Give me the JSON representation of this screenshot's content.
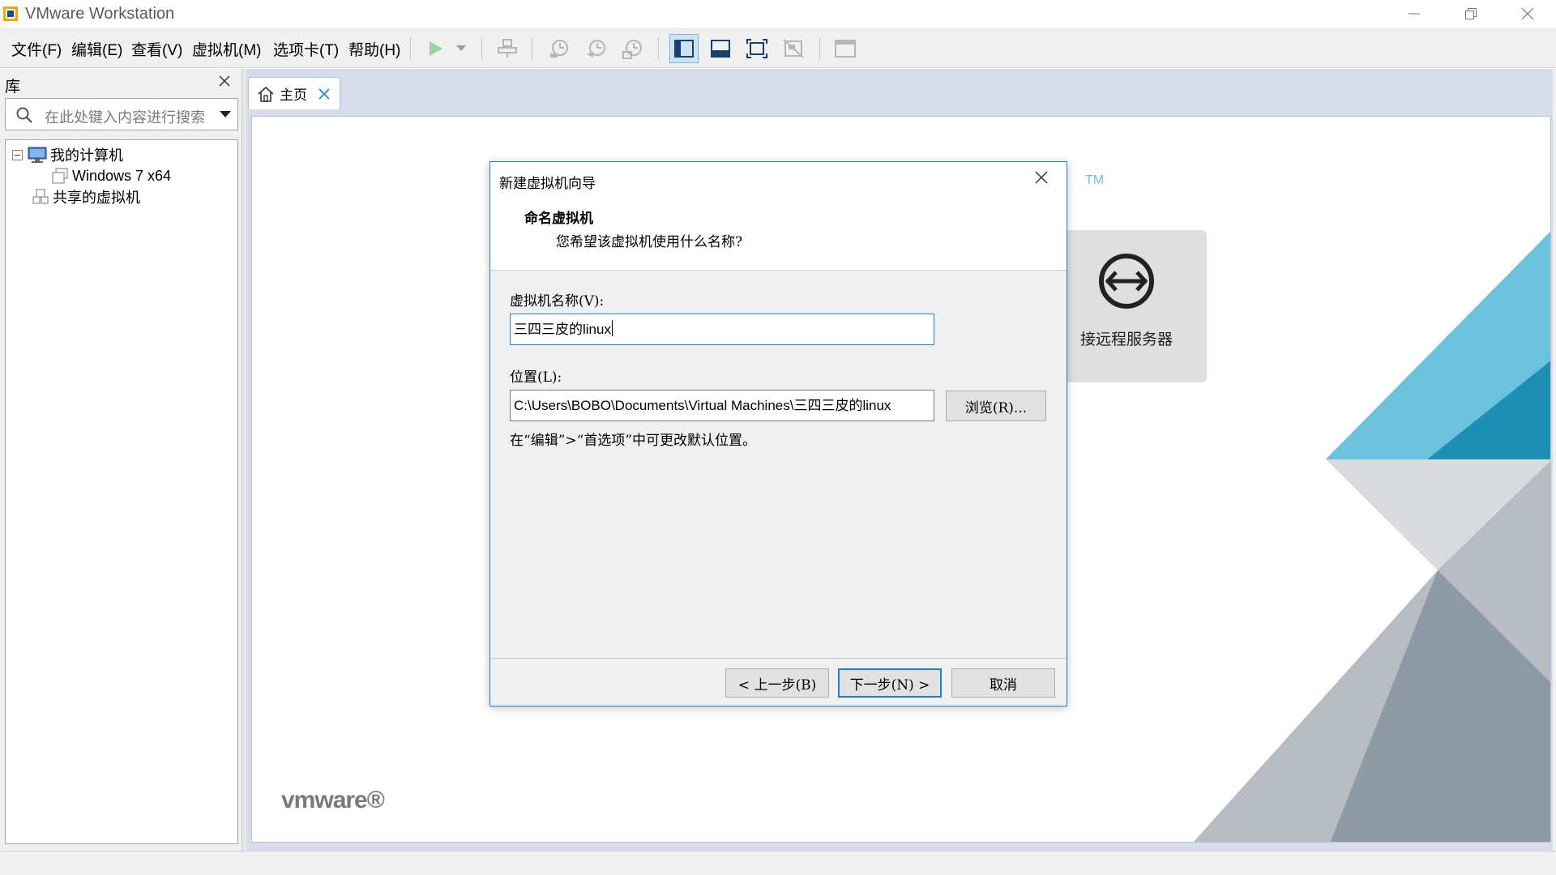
{
  "window": {
    "title": "VMware Workstation"
  },
  "menu": {
    "items": [
      "文件(F)",
      "编辑(E)",
      "查看(V)",
      "虚拟机(M)",
      "选项卡(T)",
      "帮助(H)"
    ]
  },
  "toolbar": {
    "icons": [
      "play-icon",
      "play-dropdown-icon",
      "send-ctrl-alt-del-icon",
      "snapshot-take-icon",
      "snapshot-revert-icon",
      "snapshot-manager-icon",
      "show-library-icon",
      "show-thumbnail-bar-icon",
      "full-screen-icon",
      "unity-icon",
      "console-view-icon"
    ],
    "active_icon": "show-library-icon"
  },
  "library": {
    "header": "库",
    "search_placeholder": "在此处键入内容进行搜索",
    "tree": [
      {
        "label": "我的计算机",
        "level": 0,
        "expanded": true
      },
      {
        "label": "Windows 7 x64",
        "level": 1
      },
      {
        "label": "共享的虚拟机",
        "level": 0
      }
    ]
  },
  "tabs": [
    {
      "label": "主页",
      "icon": "home-icon",
      "active": true
    }
  ],
  "home": {
    "trademark": "TM",
    "remote_server_label": "接远程服务器",
    "brand": "vmware®"
  },
  "dialog": {
    "title": "新建虚拟机向导",
    "heading": "命名虚拟机",
    "subheading": "您希望该虚拟机使用什么名称?",
    "name_label": "虚拟机名称(V):",
    "name_value": "三四三皮的linux",
    "location_label": "位置(L):",
    "location_value": "C:\\Users\\BOBO\\Documents\\Virtual Machines\\三四三皮的linux",
    "browse_label": "浏览(R)...",
    "hint": "在“编辑”>“首选项”中可更改默认位置。",
    "back_label": "< 上一步(B)",
    "next_label": "下一步(N) >",
    "cancel_label": "取消"
  },
  "colors": {
    "accent": "#1883d7",
    "play_green": "#3cb04a",
    "vmware_teal": "#1d8fb5",
    "vmware_gray": "#8e9aa3"
  }
}
